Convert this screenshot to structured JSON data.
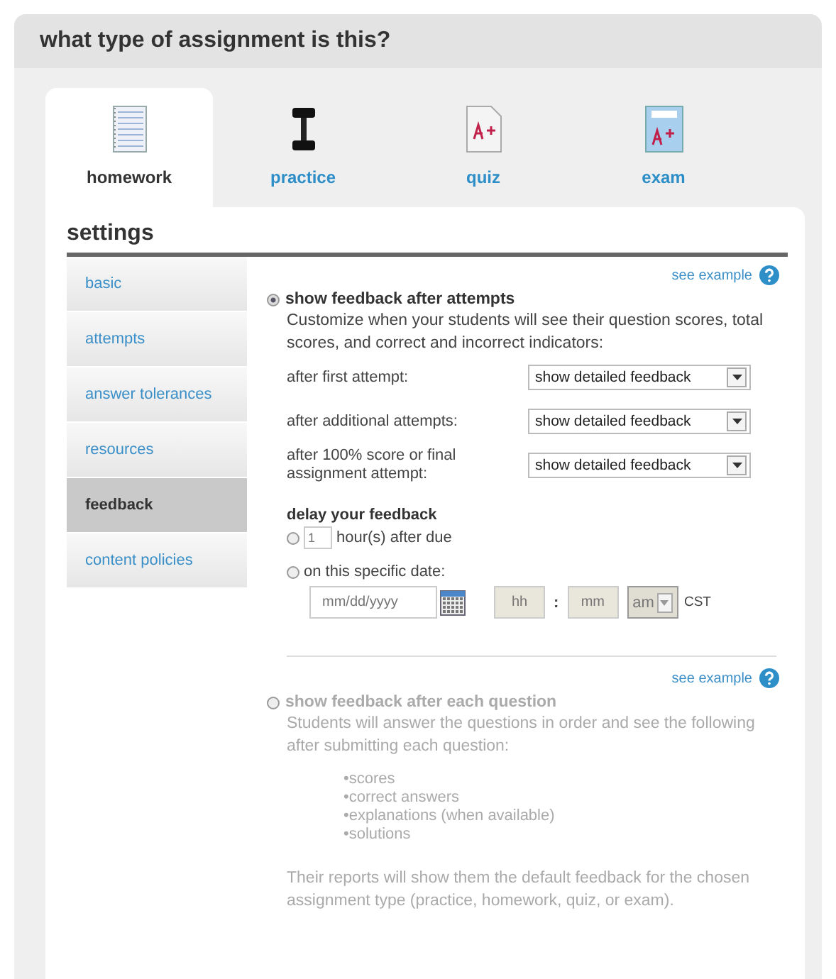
{
  "header": {
    "title": "what type of assignment is this?"
  },
  "assignment_types": [
    {
      "label": "homework",
      "kind": "notebook",
      "selected": true
    },
    {
      "label": "practice",
      "kind": "dumbbell",
      "selected": false
    },
    {
      "label": "quiz",
      "kind": "paper",
      "selected": false
    },
    {
      "label": "exam",
      "kind": "board",
      "selected": false
    }
  ],
  "settings": {
    "title": "settings",
    "sidebar": [
      {
        "label": "basic",
        "selected": false
      },
      {
        "label": "attempts",
        "selected": false
      },
      {
        "label": "answer tolerances",
        "selected": false
      },
      {
        "label": "resources",
        "selected": false
      },
      {
        "label": "feedback",
        "selected": true
      },
      {
        "label": "content policies",
        "selected": false
      }
    ],
    "after_attempts": {
      "see_example": "see example",
      "selected": true,
      "disabled": false,
      "label": "show feedback after attempts",
      "description": "Customize when your students will see their question scores, total scores, and correct and incorrect indicators:",
      "rows": [
        {
          "label": "after first attempt:",
          "value": "show detailed feedback"
        },
        {
          "label": "after additional attempts:",
          "value": "show detailed feedback"
        },
        {
          "label": "after 100% score or final assignment attempt:",
          "value": "show detailed feedback"
        }
      ],
      "delay": {
        "title": "delay your feedback",
        "hours_option": {
          "selected": false,
          "placeholder": "1",
          "label": "hour(s) after due"
        },
        "date_option": {
          "selected": false,
          "label": "on this specific date:",
          "date_placeholder": "mm/dd/yyyy",
          "hour_placeholder": "hh",
          "separator": ":",
          "minute_placeholder": "mm",
          "ampm": "am",
          "timezone": "CST"
        }
      }
    },
    "after_each_question": {
      "see_example": "see example",
      "selected": false,
      "disabled": true,
      "label": "show feedback after each question",
      "description": "Students will answer the questions in order and see the following after submitting each question:",
      "bullets": [
        "•scores",
        "•correct answers",
        "•explanations (when available)",
        "•solutions"
      ],
      "note": "Their reports will show them the default feedback for the chosen assignment type (practice, homework, quiz, or exam)."
    }
  }
}
